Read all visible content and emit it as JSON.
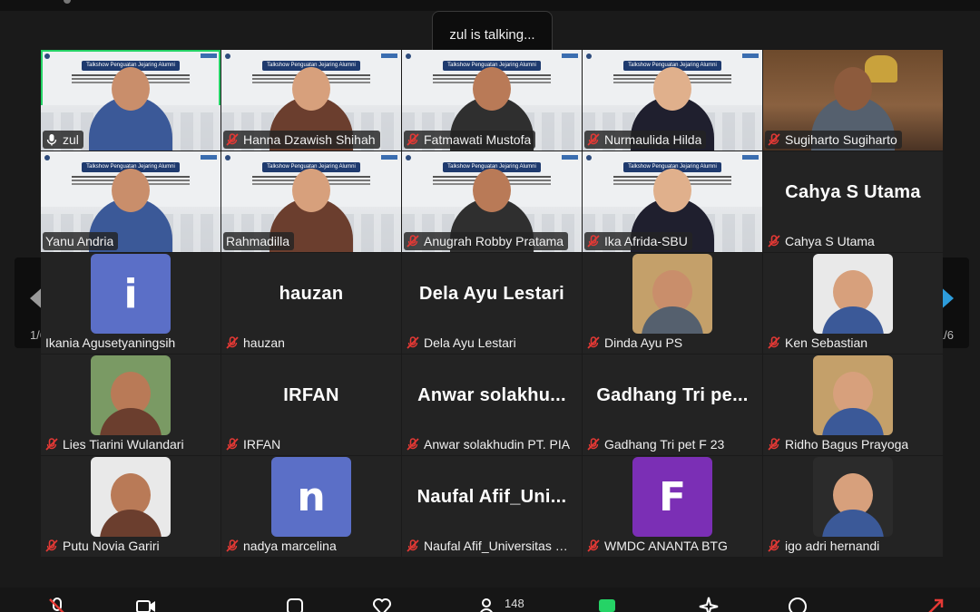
{
  "speaking_indicator": "zul is talking...",
  "pagination": {
    "left_label": "1/6",
    "right_label": "1/6"
  },
  "video_banner_text": "Talkshow Penguatan Jejaring Alumni",
  "participants": [
    {
      "name": "zul",
      "kind": "video",
      "mic": "on",
      "active": true
    },
    {
      "name": "Hanna Dzawish Shihah",
      "kind": "video",
      "mic": "muted"
    },
    {
      "name": "Fatmawati Mustofa",
      "kind": "video",
      "mic": "muted"
    },
    {
      "name": "Nurmaulida Hilda",
      "kind": "video",
      "mic": "muted"
    },
    {
      "name": "Sugiharto Sugiharto",
      "kind": "video-room",
      "mic": "muted"
    },
    {
      "name": "Yanu Andria",
      "kind": "video",
      "mic": "none"
    },
    {
      "name": "Rahmadilla",
      "kind": "video",
      "mic": "none"
    },
    {
      "name": "Anugrah Robby Pratama",
      "kind": "video",
      "mic": "muted"
    },
    {
      "name": "Ika Afrida-SBU",
      "kind": "video",
      "mic": "muted"
    },
    {
      "name": "Cahya S Utama",
      "display": "Cahya S Utama",
      "kind": "text",
      "mic": "muted"
    },
    {
      "name": "Ikania Agusetyaningsih",
      "kind": "letter",
      "letter": "i",
      "avatar_color": "#5b6fc7",
      "mic": "none"
    },
    {
      "name": "hauzan",
      "display": "hauzan",
      "kind": "text",
      "mic": "muted"
    },
    {
      "name": "Dela Ayu Lestari",
      "display": "Dela Ayu Lestari",
      "kind": "text",
      "mic": "muted"
    },
    {
      "name": "Dinda Ayu PS",
      "kind": "photo",
      "mic": "muted"
    },
    {
      "name": "Ken Sebastian",
      "kind": "photo",
      "mic": "muted"
    },
    {
      "name": "Lies Tiarini Wulandari",
      "kind": "photo",
      "mic": "muted"
    },
    {
      "name": "IRFAN",
      "display": "IRFAN",
      "kind": "text",
      "mic": "muted"
    },
    {
      "name": "Anwar solakhudin PT. PIA",
      "display": "Anwar solakhu...",
      "kind": "text",
      "mic": "muted"
    },
    {
      "name": "Gadhang Tri pet F 23",
      "display": "Gadhang Tri pe...",
      "kind": "text",
      "mic": "muted"
    },
    {
      "name": "Ridho Bagus Prayoga",
      "kind": "photo",
      "mic": "muted"
    },
    {
      "name": "Putu Novia Gariri",
      "kind": "photo",
      "mic": "muted"
    },
    {
      "name": "nadya marcelina",
      "kind": "letter",
      "letter": "n",
      "avatar_color": "#5b6fc7",
      "mic": "muted"
    },
    {
      "name": "Naufal Afif_Universitas Di...",
      "display": "Naufal Afif_Uni...",
      "kind": "text",
      "mic": "muted"
    },
    {
      "name": "WMDC ANANTA BTG",
      "kind": "letter",
      "letter": "F",
      "avatar_color": "#7b2fb5",
      "mic": "muted"
    },
    {
      "name": "igo adri hernandi",
      "kind": "photo",
      "mic": "muted"
    }
  ],
  "toolbar": {
    "participants_count": "148"
  },
  "colors": {
    "active_speaker": "#25d366",
    "muted_icon": "#e53935",
    "background": "#1a1a1a"
  }
}
